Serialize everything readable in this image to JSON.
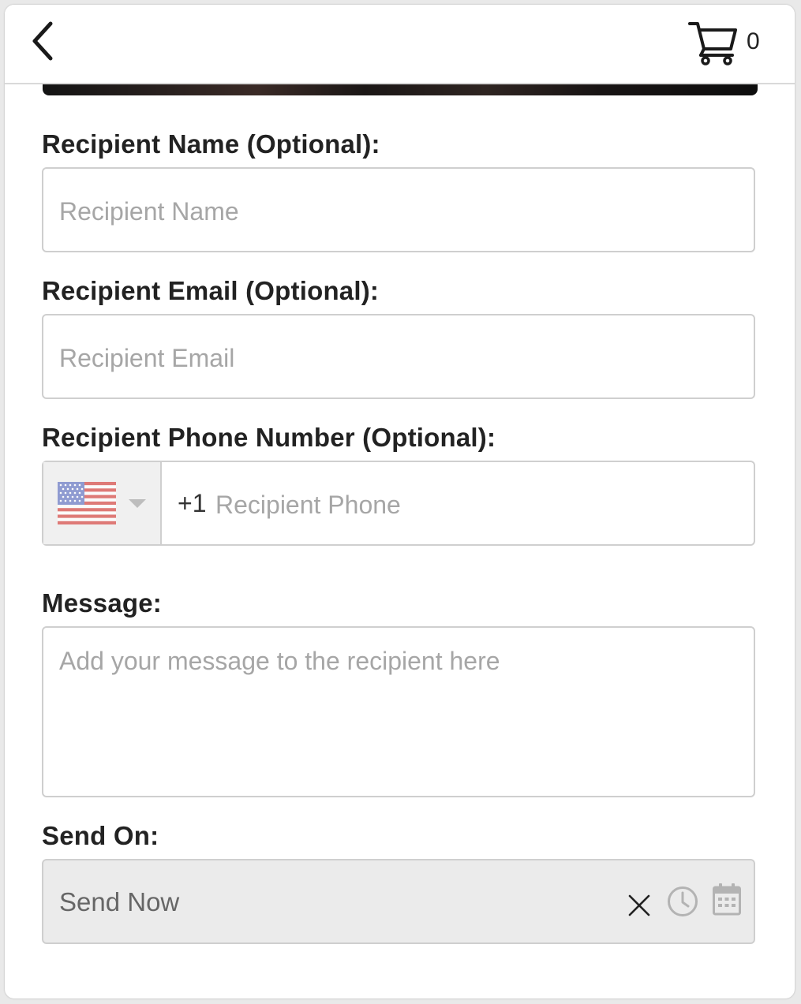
{
  "header": {
    "back_icon": "chevron-left-icon",
    "cart_icon": "shopping-cart-icon",
    "cart_count": "0"
  },
  "form": {
    "recipient_name": {
      "label": "Recipient Name (Optional):",
      "placeholder": "Recipient Name",
      "value": ""
    },
    "recipient_email": {
      "label": "Recipient Email (Optional):",
      "placeholder": "Recipient Email",
      "value": ""
    },
    "recipient_phone": {
      "label": "Recipient Phone Number (Optional):",
      "country_flag": "us-flag-icon",
      "dial_code": "+1",
      "placeholder": "Recipient Phone",
      "value": ""
    },
    "message": {
      "label": "Message:",
      "placeholder": "Add your message to the recipient here",
      "value": ""
    },
    "send_on": {
      "label": "Send On:",
      "value": "Send Now",
      "icons": [
        "clear-icon",
        "clock-icon",
        "calendar-icon"
      ]
    }
  },
  "colors": {
    "label_text": "#222222",
    "placeholder_text": "#a6a6a6",
    "border": "#cfcfcf",
    "disabled_bg": "#ebebeb"
  }
}
